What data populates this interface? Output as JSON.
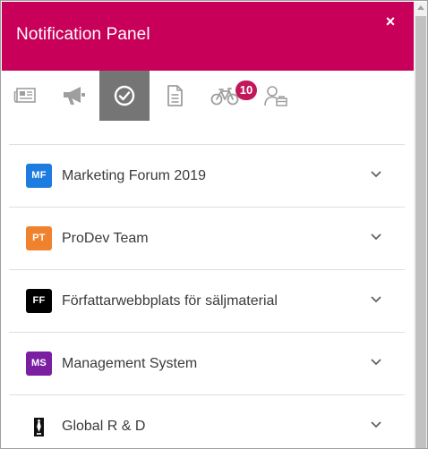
{
  "colors": {
    "header_bg": "#c8005a",
    "header_text": "#ffffff",
    "active_tab_bg": "#757575",
    "icon_gray": "#9e9e9e",
    "badge_bg": "#c2185b"
  },
  "header": {
    "title": "Notification Panel",
    "close_label": "×",
    "close_icon": "close-icon"
  },
  "tabs": [
    {
      "icon": "newspaper-icon",
      "active": false
    },
    {
      "icon": "megaphone-icon",
      "active": false
    },
    {
      "icon": "check-circle-icon",
      "active": true
    },
    {
      "icon": "document-icon",
      "active": false
    },
    {
      "icon": "bicycle-icon",
      "active": false,
      "badge": "10"
    },
    {
      "icon": "user-briefcase-icon",
      "active": false
    }
  ],
  "groups": [
    {
      "initials": "MF",
      "name": "Marketing Forum 2019",
      "color": "#1e7be0"
    },
    {
      "initials": "PT",
      "name": "ProDev Team",
      "color": "#f0822e"
    },
    {
      "initials": "FF",
      "name": "Författarwebbplats för säljmaterial",
      "color": "#000000"
    },
    {
      "initials": "MS",
      "name": "Management System",
      "color": "#7b1fa2"
    },
    {
      "initials": "",
      "name": "Global R & D",
      "color": "#000000",
      "avatar_icon": "logo-image-icon"
    }
  ]
}
